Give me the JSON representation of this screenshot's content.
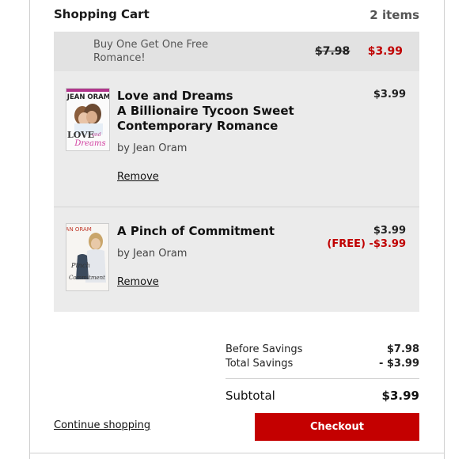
{
  "cart": {
    "title": "Shopping Cart",
    "count": "2 items"
  },
  "promo": {
    "text": "Buy One Get One Free Romance!",
    "original_price": "$7.98",
    "sale_price": "$3.99"
  },
  "items": [
    {
      "title_line1": "Love and Dreams",
      "title_line2": "A Billionaire Tycoon Sweet",
      "title_line3": "Contemporary Romance",
      "author": "by Jean Oram",
      "remove": "Remove",
      "price": "$3.99",
      "cover": {
        "author_text": "JEAN ORAM",
        "title_text": "LOVE",
        "title_text2": "and",
        "title_text3": "Dreams"
      }
    },
    {
      "title_line1": "A Pinch of Commitment",
      "author": "by Jean Oram",
      "remove": "Remove",
      "price": "$3.99",
      "free_note": "(FREE) -$3.99",
      "cover": {
        "author_text": "JEAN ORAM",
        "title_text": "Pinch",
        "title_text2": "Commitment"
      }
    }
  ],
  "summary": {
    "before_savings_label": "Before Savings",
    "before_savings_value": "$7.98",
    "total_savings_label": "Total Savings",
    "total_savings_value": "- $3.99",
    "subtotal_label": "Subtotal",
    "subtotal_value": "$3.99"
  },
  "actions": {
    "continue": "Continue shopping",
    "checkout": "Checkout"
  },
  "colors": {
    "accent": "#c40000",
    "sale": "#c00000",
    "panel": "#ebebeb"
  }
}
